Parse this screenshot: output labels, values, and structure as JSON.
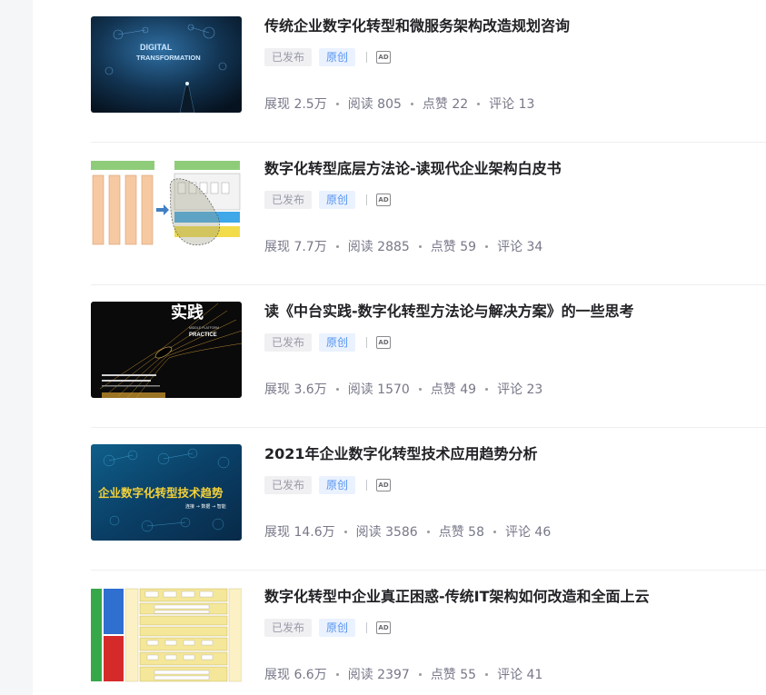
{
  "articles": [
    {
      "title": "传统企业数字化转型和微服务架构改造规划咨询",
      "status": "已发布",
      "type": "原创",
      "ad_label": "AD",
      "thumb_text": [
        "DIGITAL",
        "TRANSFORMATION"
      ],
      "stats": {
        "views": "展现 2.5万",
        "reads": "阅读 805",
        "likes": "点赞 22",
        "comments": "评论 13"
      }
    },
    {
      "title": "数字化转型底层方法论-读现代企业架构白皮书",
      "status": "已发布",
      "type": "原创",
      "ad_label": "AD",
      "stats": {
        "views": "展现 7.7万",
        "reads": "阅读 2885",
        "likes": "点赞 59",
        "comments": "评论 34"
      }
    },
    {
      "title": "读《中台实践-数字化转型方法论与解决方案》的一些思考",
      "status": "已发布",
      "type": "原创",
      "ad_label": "AD",
      "thumb_text": [
        "实践",
        "MIDDLE PLATFORM",
        "PRACTICE"
      ],
      "stats": {
        "views": "展现 3.6万",
        "reads": "阅读 1570",
        "likes": "点赞 49",
        "comments": "评论 23"
      }
    },
    {
      "title": "2021年企业数字化转型技术应用趋势分析",
      "status": "已发布",
      "type": "原创",
      "ad_label": "AD",
      "thumb_text": [
        "企业数字化转型技术趋势",
        "连接 → 数据 → 智能"
      ],
      "stats": {
        "views": "展现 14.6万",
        "reads": "阅读 3586",
        "likes": "点赞 58",
        "comments": "评论 46"
      }
    },
    {
      "title": "数字化转型中企业真正困惑-传统IT架构如何改造和全面上云",
      "status": "已发布",
      "type": "原创",
      "ad_label": "AD",
      "stats": {
        "views": "展现 6.6万",
        "reads": "阅读 2397",
        "likes": "点赞 55",
        "comments": "评论 41"
      }
    }
  ],
  "colors": {
    "title": "#222226",
    "meta": "#777888",
    "tag_original": "#5593f0",
    "tag_published": "#999aaa"
  }
}
